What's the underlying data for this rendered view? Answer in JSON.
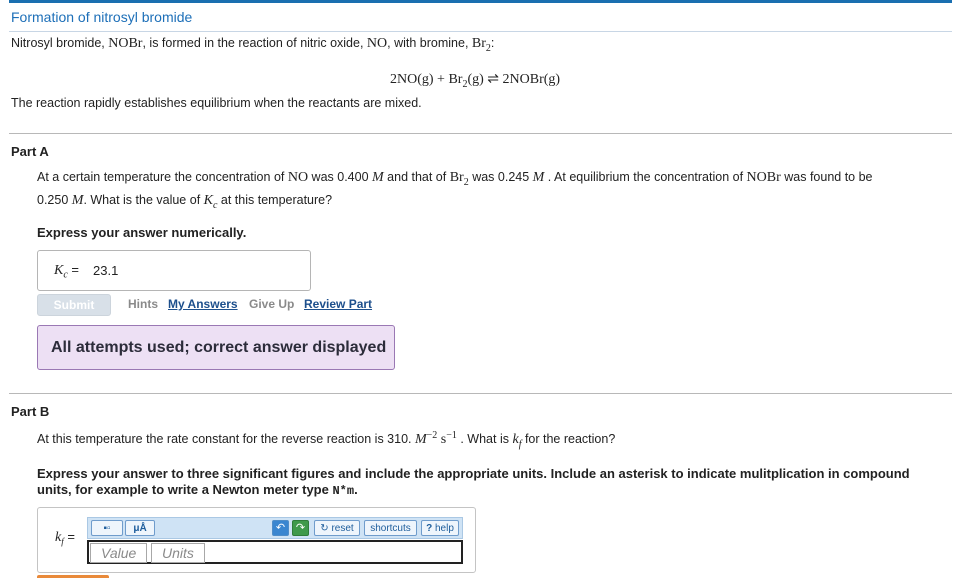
{
  "problem": {
    "title": "Formation of nitrosyl bromide",
    "intro_1": "Nitrosyl bromide, ",
    "nobr": "NOBr",
    "intro_2": ", is formed in the reaction of nitric oxide, ",
    "no": "NO",
    "intro_3": ", with bromine, ",
    "br2": "Br",
    "br2_sub": "2",
    "intro_4": ":",
    "equation": {
      "lhs_1": "2NO(g) + Br",
      "lhs_sub": "2",
      "lhs_2": "(g) ",
      "arrow": "⇌",
      "rhs": " 2NOBr(g)"
    },
    "equilibrium_text": "The reaction rapidly establishes equilibrium when the reactants are mixed."
  },
  "partA": {
    "title": "Part A",
    "q_1": "At a certain temperature the concentration of ",
    "no": "NO",
    "q_2": " was 0.400 ",
    "M": "M",
    "q_3": " and that of ",
    "br2": "Br",
    "br2_sub": "2",
    "q_4": " was 0.245 ",
    "q_5": " . At equilibrium the concentration of ",
    "nobr": "NOBr",
    "q_6": " was found to be",
    "q_7": "0.250 ",
    "q_8": ". What is the value of ",
    "K": "K",
    "K_sub": "c",
    "q_9": " at this temperature?",
    "express": "Express your answer numerically.",
    "answer_label_eq": " = ",
    "answer_value": "23.1",
    "submit_label": "Submit",
    "hints_label": "Hints",
    "my_answers_label": "My Answers",
    "give_up_label": "Give Up",
    "review_part_label": "Review Part",
    "feedback": "All attempts used; correct answer displayed"
  },
  "partB": {
    "title": "Part B",
    "q_1": "At this temperature the rate constant for the reverse reaction is 310. ",
    "M": "M",
    "M_exp": "−2",
    "s": " s",
    "s_exp": "−1",
    "q_2": " . What is ",
    "k": "k",
    "k_sub": "f",
    "q_3": " for the reaction?",
    "express_1": "Express your answer to three significant figures and include the appropriate units. Include an asterisk to indicate mulitplication in compound",
    "express_2": "units, for example to write a Newton meter type ",
    "express_code": "N*m",
    "express_end": ".",
    "label_eq": " = ",
    "toolbar": {
      "template_icon": "▪▫",
      "units_label": "μÅ",
      "undo_icon": "↶",
      "redo_icon": "↷",
      "reset_label": "reset",
      "shortcuts_label": "shortcuts",
      "help_label": "help"
    },
    "value_placeholder": "Value",
    "units_placeholder": "Units"
  },
  "colors": {
    "title": "#1d6fb8",
    "link": "#1d4f8c",
    "feedback_bg": "#ede0f4",
    "feedback_border": "#9a78b4",
    "toolbar_bg": "#cfe3f5"
  }
}
